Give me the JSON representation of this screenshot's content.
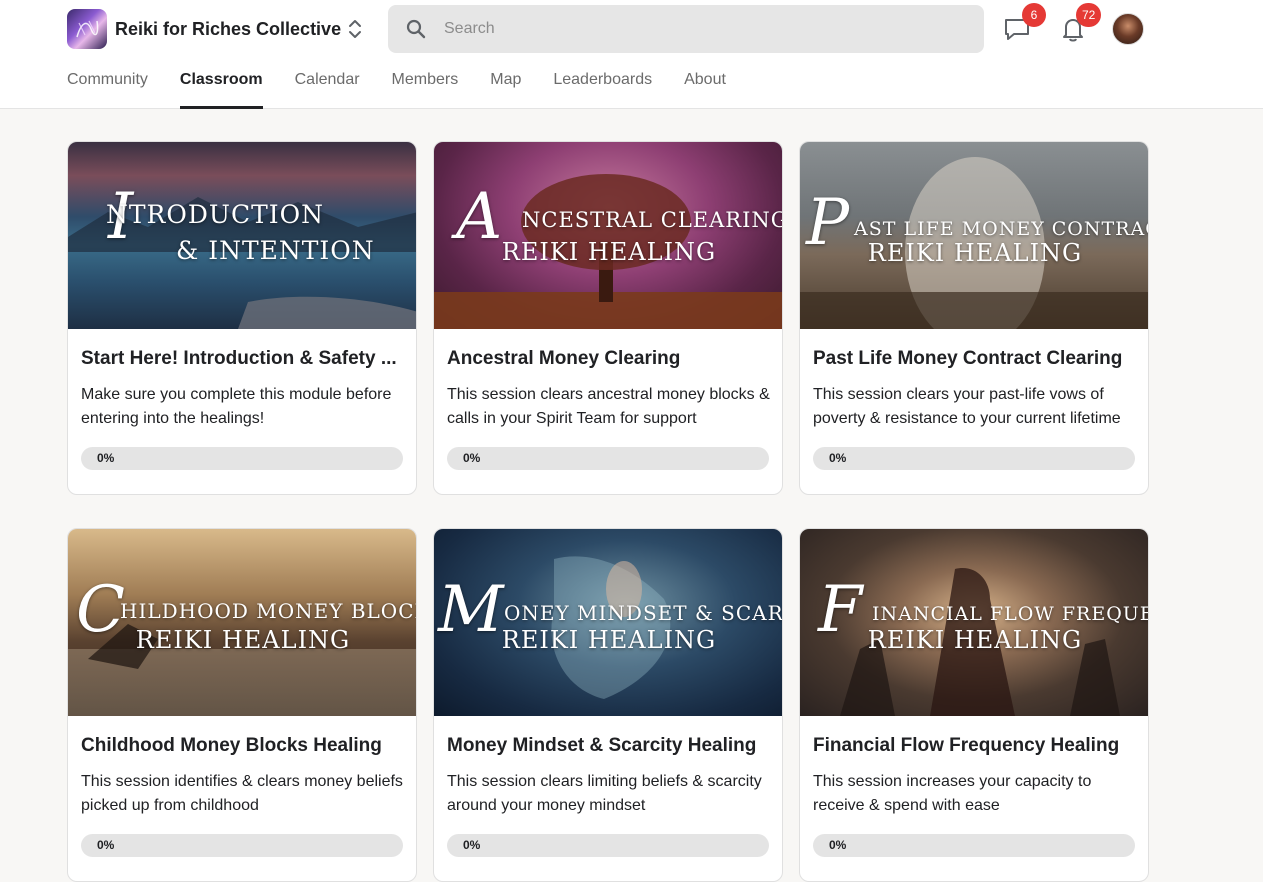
{
  "app": {
    "name": "Reiki for Riches Collective"
  },
  "search": {
    "placeholder": "Search"
  },
  "notifications": {
    "chat_count": "6",
    "bell_count": "72"
  },
  "tabs": [
    {
      "label": "Community",
      "active": false
    },
    {
      "label": "Classroom",
      "active": true
    },
    {
      "label": "Calendar",
      "active": false
    },
    {
      "label": "Members",
      "active": false
    },
    {
      "label": "Map",
      "active": false
    },
    {
      "label": "Leaderboards",
      "active": false
    },
    {
      "label": "About",
      "active": false
    }
  ],
  "courses": [
    {
      "image_script": "I",
      "image_line1": "NTRODUCTION",
      "image_line2": "& INTENTION",
      "title": "Start Here! Introduction & Safety ...",
      "description": "Make sure you complete this module before entering into the healings!",
      "progress_label": "0%",
      "progress": 0
    },
    {
      "image_script": "A",
      "image_line1": "NCESTRAL CLEARING",
      "image_line2": "REIKI HEALING",
      "title": "Ancestral Money Clearing",
      "description": "This session clears ancestral money blocks & calls in your Spirit Team for support",
      "progress_label": "0%",
      "progress": 0
    },
    {
      "image_script": "P",
      "image_line1": "AST LIFE MONEY CONTRACTS",
      "image_line2": "REIKI HEALING",
      "title": "Past Life Money Contract Clearing",
      "description": "This session clears your past-life vows of poverty & resistance to your current lifetime",
      "progress_label": "0%",
      "progress": 0
    },
    {
      "image_script": "C",
      "image_line1": "HILDHOOD MONEY BLOCKS",
      "image_line2": "REIKI HEALING",
      "title": "Childhood Money Blocks Healing",
      "description": "This session identifies & clears money beliefs picked up from childhood",
      "progress_label": "0%",
      "progress": 0
    },
    {
      "image_script": "M",
      "image_line1": "ONEY MINDSET & SCARCITY",
      "image_line2": "REIKI HEALING",
      "title": "Money Mindset & Scarcity Healing",
      "description": "This session clears limiting beliefs & scarcity around your money mindset",
      "progress_label": "0%",
      "progress": 0
    },
    {
      "image_script": "F",
      "image_line1": "INANCIAL FLOW FREQUENCY",
      "image_line2": "REIKI HEALING",
      "title": "Financial Flow Frequency Healing",
      "description": "This session increases your capacity to receive & spend with ease",
      "progress_label": "0%",
      "progress": 0
    }
  ],
  "colors": {
    "badge": "#e53935",
    "progress_track": "#e4e4e4",
    "progress_fill": "#f5c518"
  }
}
